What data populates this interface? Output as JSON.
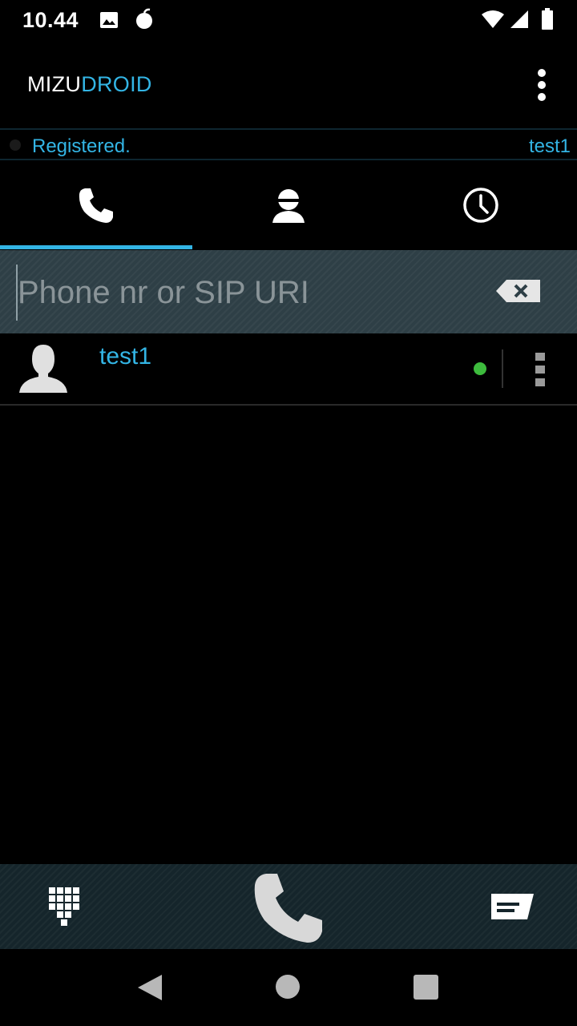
{
  "status_bar": {
    "time": "10.44",
    "icons": [
      "image-icon",
      "app-notification-icon",
      "wifi-icon",
      "signal-icon",
      "battery-icon"
    ]
  },
  "app_bar": {
    "title_part1": "MIZU",
    "title_part2": "DROID",
    "menu_icon": "overflow-menu-icon"
  },
  "registration": {
    "status": "Registered.",
    "username": "test1"
  },
  "tabs": [
    {
      "icon": "phone-icon",
      "selected": true
    },
    {
      "icon": "contacts-icon",
      "selected": false
    },
    {
      "icon": "history-clock-icon",
      "selected": false
    }
  ],
  "dial": {
    "value": "",
    "placeholder": "Phone nr or SIP URI",
    "clear_icon": "backspace-icon"
  },
  "contacts": [
    {
      "name": "test1",
      "presence": "online",
      "avatar_icon": "person-avatar-icon"
    }
  ],
  "bottom_bar": {
    "left_icon": "dialpad-icon",
    "center_icon": "call-icon",
    "right_icon": "message-icon"
  },
  "colors": {
    "accent": "#33b5e5",
    "online": "#3dbb3d",
    "dial_bg": "#2e3f46",
    "bottom_bg": "#15252b"
  }
}
